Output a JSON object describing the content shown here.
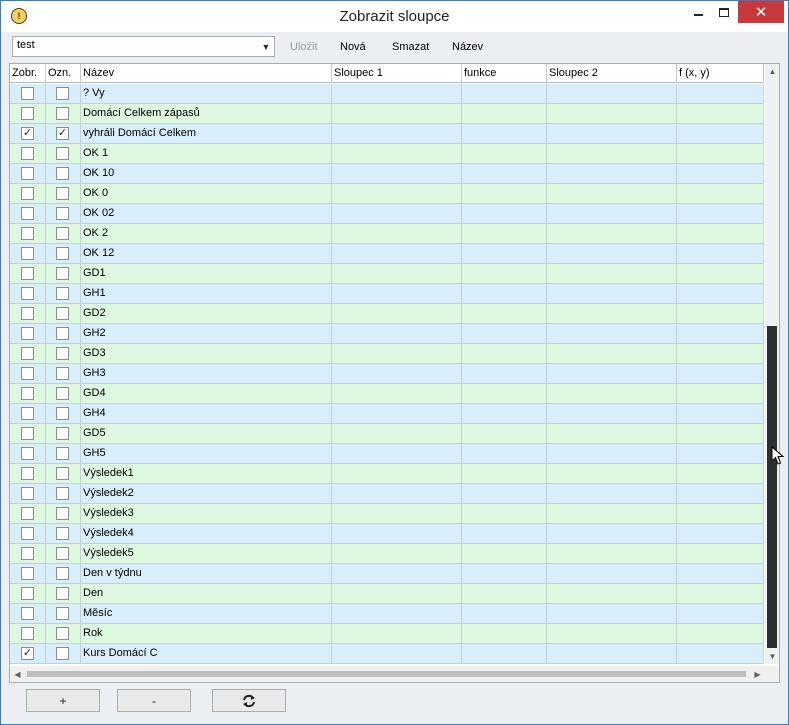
{
  "window": {
    "title": "Zobrazit sloupce",
    "minimize_glyph": "—",
    "close_glyph": "✕"
  },
  "toolbar": {
    "combo_value": "test",
    "save_label": "Uložit",
    "new_label": "Nová",
    "delete_label": "Smazat",
    "name_label": "Název"
  },
  "table": {
    "columns": [
      "Zobr.",
      "Ozn.",
      "Název",
      "Sloupec 1",
      "funkce",
      "Sloupec 2",
      "f (x, y)"
    ],
    "rows": [
      {
        "show": false,
        "mark": false,
        "name": "? Vy"
      },
      {
        "show": false,
        "mark": false,
        "name": "Domácí Celkem zápasů"
      },
      {
        "show": true,
        "mark": true,
        "name": "vyhráli Domácí Celkem"
      },
      {
        "show": false,
        "mark": false,
        "name": "OK 1"
      },
      {
        "show": false,
        "mark": false,
        "name": "OK 10"
      },
      {
        "show": false,
        "mark": false,
        "name": "OK 0"
      },
      {
        "show": false,
        "mark": false,
        "name": "OK 02"
      },
      {
        "show": false,
        "mark": false,
        "name": "OK 2"
      },
      {
        "show": false,
        "mark": false,
        "name": "OK 12"
      },
      {
        "show": false,
        "mark": false,
        "name": "GD1"
      },
      {
        "show": false,
        "mark": false,
        "name": "GH1"
      },
      {
        "show": false,
        "mark": false,
        "name": "GD2"
      },
      {
        "show": false,
        "mark": false,
        "name": "GH2"
      },
      {
        "show": false,
        "mark": false,
        "name": "GD3"
      },
      {
        "show": false,
        "mark": false,
        "name": "GH3"
      },
      {
        "show": false,
        "mark": false,
        "name": "GD4"
      },
      {
        "show": false,
        "mark": false,
        "name": "GH4"
      },
      {
        "show": false,
        "mark": false,
        "name": "GD5"
      },
      {
        "show": false,
        "mark": false,
        "name": "GH5"
      },
      {
        "show": false,
        "mark": false,
        "name": "Výsledek1"
      },
      {
        "show": false,
        "mark": false,
        "name": "Výsledek2"
      },
      {
        "show": false,
        "mark": false,
        "name": "Výsledek3"
      },
      {
        "show": false,
        "mark": false,
        "name": "Výsledek4"
      },
      {
        "show": false,
        "mark": false,
        "name": "Výsledek5"
      },
      {
        "show": false,
        "mark": false,
        "name": "Den v týdnu"
      },
      {
        "show": false,
        "mark": false,
        "name": "Den"
      },
      {
        "show": false,
        "mark": false,
        "name": "Měsíc"
      },
      {
        "show": false,
        "mark": false,
        "name": "Rok"
      },
      {
        "show": true,
        "mark": false,
        "name": "Kurs Domácí C"
      }
    ]
  },
  "footer": {
    "add_label": "+",
    "remove_label": "-",
    "refresh_icon": "refresh-icon"
  },
  "colors": {
    "row_even": "#d8eefb",
    "row_odd": "#ddf8df",
    "close_button": "#c9383a"
  }
}
